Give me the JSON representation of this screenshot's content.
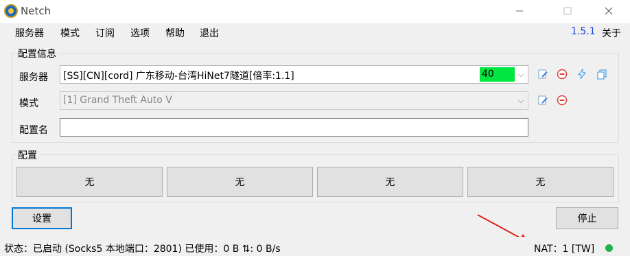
{
  "window": {
    "title": "Netch"
  },
  "menu": {
    "items": [
      "服务器",
      "模式",
      "订阅",
      "选项",
      "帮助",
      "退出"
    ],
    "version": "1.5.1",
    "about": "关于"
  },
  "config_info": {
    "group_title": "配置信息",
    "server_label": "服务器",
    "server_value": "[SS][CN][cord] 广东移动-台湾HiNet7隧道[倍率:1.1]",
    "server_delay": "40",
    "mode_label": "模式",
    "mode_value": "[1] Grand Theft Auto V",
    "profile_name_label": "配置名",
    "profile_name_value": ""
  },
  "profiles": {
    "group_title": "配置",
    "buttons": [
      "无",
      "无",
      "无",
      "无"
    ]
  },
  "actions": {
    "settings": "设置",
    "stop": "停止"
  },
  "status": {
    "text": "状态：已启动 (Socks5 本地端口：2801)  已使用：0 B  ⇅: 0 B/s",
    "nat": "NAT：1 [TW]",
    "nat_color": "#22b14c"
  },
  "colors": {
    "delay_bg": "#00e640",
    "accent": "#0078d7",
    "arrow": "#e0201b"
  },
  "icons": [
    "netch-app-icon",
    "minimize-icon",
    "maximize-icon",
    "close-icon",
    "edit-icon",
    "delete-icon",
    "speedtest-icon",
    "copy-icon",
    "chevron-down-icon",
    "status-dot-icon"
  ]
}
